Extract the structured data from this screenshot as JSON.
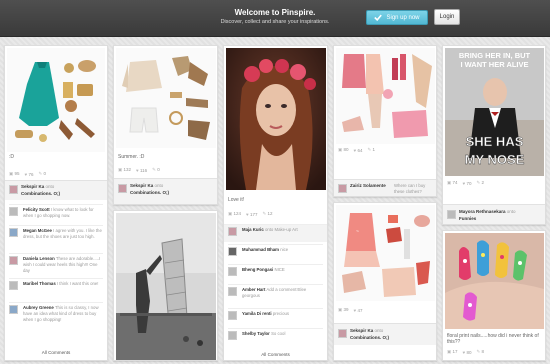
{
  "header": {
    "title": "Welcome to Pinspire.",
    "subtitle": "Discover, collect and share your inspirations.",
    "signup_label": "Sign up now",
    "login_label": "Login"
  },
  "colors": {
    "accent": "#52b8d3",
    "topbar": "#444444"
  },
  "icons": [
    "check-icon",
    "repin-icon",
    "like-icon",
    "comment-icon"
  ],
  "pins": [
    {
      "caption": ":D",
      "stats": [
        "95",
        "76",
        "0"
      ],
      "pinner": "Sekspir Ka",
      "onto": "onto",
      "board": "Combinations. O;)",
      "comments": [
        {
          "name": "Felicity Scott",
          "text": "I know what to look for when I go shopping now."
        },
        {
          "name": "Megan McGee",
          "text": "I agree with you. I like the dress, but the shoes are just too high."
        },
        {
          "name": "Daniela Lenson",
          "text": "These are adorable.....I wish I could wear heels this high!!! One day"
        },
        {
          "name": "Maribel Thomas",
          "text": "I think I want this one!"
        },
        {
          "name": "Aubrey Greene",
          "text": "This is so classy, I now have an idea what kind of dress to buy when I go shopping!"
        }
      ],
      "all_comments": "All Comments"
    },
    {
      "caption": "Summer. :D",
      "stats": [
        "132",
        "116",
        "0"
      ],
      "pinner": "Sekspir Ka",
      "onto": "onto",
      "board": "Combinations. O;)"
    },
    {
      "caption": "Love it!",
      "stats": [
        "124",
        "177",
        "12"
      ],
      "comments": [
        {
          "name": "Maja Kuric",
          "text": "onto Make-up Art"
        },
        {
          "name": "Muhammad Bham",
          "text": "nice"
        },
        {
          "name": "Bheng Pongasi",
          "text": "NICE"
        },
        {
          "name": "Amber Hart",
          "text": "Add a comment!Slee georgous"
        },
        {
          "name": "Yamila Di renti",
          "text": "precious"
        },
        {
          "name": "Shelby Taylor",
          "text": "So cool"
        }
      ],
      "all_comments": "All Comments"
    },
    {
      "caption": "",
      "stats": [
        "80",
        "64",
        "1"
      ],
      "pinner": "Zairiz Solamente",
      "onto": "Where can I buy these clothes?"
    },
    {
      "caption": "",
      "stats": [
        "39",
        "47"
      ],
      "pinner": "Sekspir Ka",
      "onto": "onto",
      "board": "Combinations. O;)"
    },
    {
      "image_text": [
        "BRING HER IN, BUT",
        "I WANT HER ALIVE",
        "SHE HAS",
        "MY NOSE"
      ],
      "stats": [
        "74",
        "70",
        "2"
      ],
      "pinner": "Mayora Rethnasekara",
      "onto": "onto",
      "board": "Funnies"
    },
    {
      "caption": "floral print nails.....how did i never think of this??",
      "stats": [
        "17",
        "80",
        "8"
      ]
    }
  ]
}
